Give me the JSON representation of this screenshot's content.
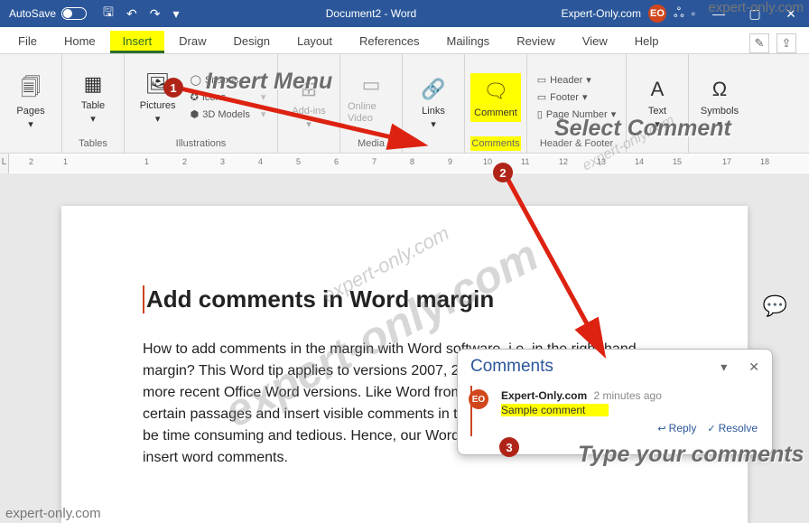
{
  "titlebar": {
    "autosave": "AutoSave",
    "doc_title": "Document2 - Word",
    "account": "Expert-Only.com",
    "avatar": "EO"
  },
  "tabs": {
    "file": "File",
    "home": "Home",
    "insert": "Insert",
    "draw": "Draw",
    "design": "Design",
    "layout": "Layout",
    "references": "References",
    "mailings": "Mailings",
    "review": "Review",
    "view": "View",
    "help": "Help"
  },
  "ribbon": {
    "pages": {
      "pages": "Pages",
      "group": ""
    },
    "tables": {
      "table": "Table",
      "group": "Tables"
    },
    "illustrations": {
      "pictures": "Pictures",
      "shapes": "Shapes",
      "icons": "Icons",
      "models3d": "3D Models",
      "group": "Illustrations"
    },
    "addins": {
      "addins": "Add-ins",
      "group": ""
    },
    "media": {
      "video": "Online Video",
      "group": "Media"
    },
    "links": {
      "links": "Links",
      "group": ""
    },
    "comments": {
      "comment": "Comment",
      "group": "Comments"
    },
    "headerfooter": {
      "header": "Header",
      "footer": "Footer",
      "pagenum": "Page Number",
      "group": "Header & Footer"
    },
    "text": {
      "text": "Text",
      "group": ""
    },
    "symbols": {
      "symbols": "Symbols",
      "group": ""
    }
  },
  "ruler_corner": "L",
  "document": {
    "heading": "Add comments in Word margin",
    "body": "How to add comments in the margin with Word software, i.e. in the right-hand margin? This Word tip applies to versions 2007, 2010, 2013, 2016, 2019 and the more recent Office Word versions. Like Word from Office 365. Indeed, to highlight certain passages and insert visible comments in the margin of the document it can be time consuming and tedious. Hence, our Word experts present the guide to insert word comments."
  },
  "comments_pane": {
    "title": "Comments",
    "author": "Expert-Only.com",
    "time": "2 minutes ago",
    "text": "Sample comment",
    "reply": "Reply",
    "resolve": "Resolve"
  },
  "annotations": {
    "c1": "Insert Menu",
    "c2": "Select Comment",
    "c3": "Type your comments",
    "n1": "1",
    "n2": "2",
    "n3": "3",
    "watermark": "expert-only.com"
  }
}
